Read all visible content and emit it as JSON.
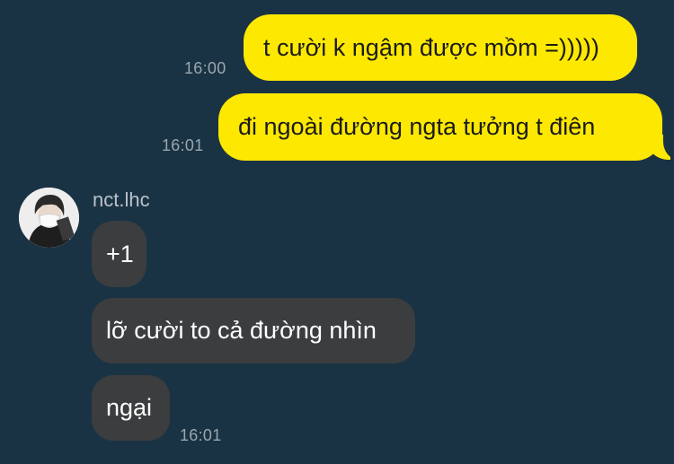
{
  "messages_out": [
    {
      "text": "t cười k ngậm được mồm =)))))",
      "time": "16:00"
    },
    {
      "text": "đi ngoài đường ngta tưởng t điên",
      "time": "16:01"
    }
  ],
  "incoming": {
    "sender": "nct.lhc",
    "avatar_icon": "person-with-mask-avatar",
    "messages": [
      {
        "text": "+1"
      },
      {
        "text": "lỡ cười to cả đường nhìn"
      },
      {
        "text": "ngại",
        "time": "16:01"
      }
    ]
  },
  "colors": {
    "background": "#1a3344",
    "outgoing_bubble": "#fde802",
    "incoming_bubble": "#3b3d3f",
    "timestamp": "#9aa6ae"
  }
}
